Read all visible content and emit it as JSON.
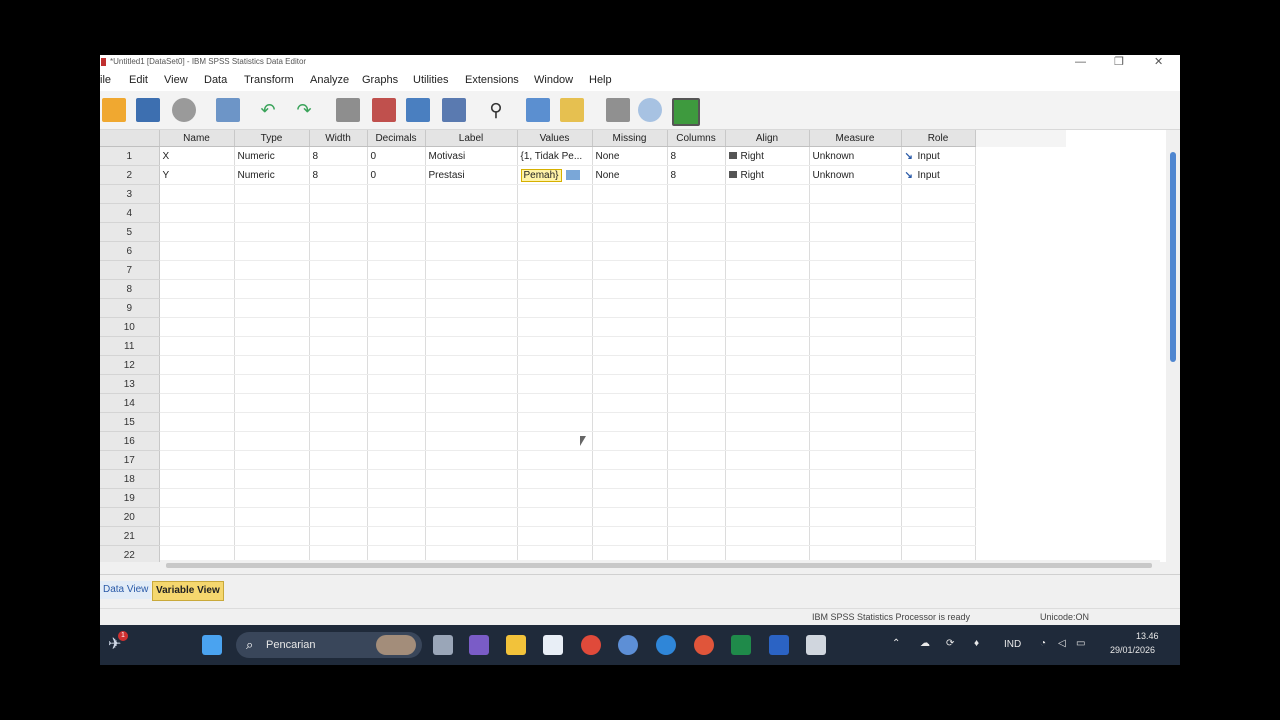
{
  "window": {
    "title": "*Untitled1 [DataSet0] - IBM SPSS Statistics Data Editor",
    "min": "—",
    "max": "❐",
    "close": "✕"
  },
  "menu": [
    "ile",
    "Edit",
    "View",
    "Data",
    "Transform",
    "Analyze",
    "Graphs",
    "Utilities",
    "Extensions",
    "Window",
    "Help"
  ],
  "toolbar_icons": [
    "open-icon",
    "save-icon",
    "print-icon",
    "dialog-recall-icon",
    "undo-icon",
    "redo-icon",
    "goto-case-icon",
    "goto-variable-icon",
    "variables-icon",
    "run-descriptives-icon",
    "find-icon",
    "insert-cases-icon",
    "insert-variable-icon",
    "split-file-icon",
    "weight-cases-icon",
    "select-cases-icon",
    "value-labels-icon",
    "use-sets-icon"
  ],
  "columns": [
    "Name",
    "Type",
    "Width",
    "Decimals",
    "Label",
    "Values",
    "Missing",
    "Columns",
    "Align",
    "Measure",
    "Role"
  ],
  "rows": [
    {
      "num": "1",
      "name": "X",
      "type": "Numeric",
      "width": "8",
      "decimals": "0",
      "label": "Motivasi",
      "values": "{1, Tidak Pe...",
      "missing": "None",
      "columns": "8",
      "align": "Right",
      "measure": "Unknown",
      "role": "Input"
    },
    {
      "num": "2",
      "name": "Y",
      "type": "Numeric",
      "width": "8",
      "decimals": "0",
      "label": "Prestasi",
      "values": "Pemah}",
      "missing": "None",
      "columns": "8",
      "align": "Right",
      "measure": "Unknown",
      "role": "Input"
    }
  ],
  "empty_rows": [
    "3",
    "4",
    "5",
    "6",
    "7",
    "8",
    "9",
    "10",
    "11",
    "12",
    "13",
    "14",
    "15",
    "16",
    "17",
    "18",
    "19",
    "20",
    "21",
    "22"
  ],
  "tabs": {
    "data_view": "Data View",
    "variable_view": "Variable View"
  },
  "status": {
    "processor": "IBM SPSS Statistics Processor is ready",
    "unicode": "Unicode:ON"
  },
  "taskbar": {
    "search_placeholder": "Pencarian",
    "lang": "IND",
    "time": "13.46",
    "date": "29/01/2026",
    "notif": "1"
  },
  "colors": {
    "accent": "#4f86d0",
    "tab_active": "#f5d76e",
    "taskbar": "#1f2a3a"
  }
}
